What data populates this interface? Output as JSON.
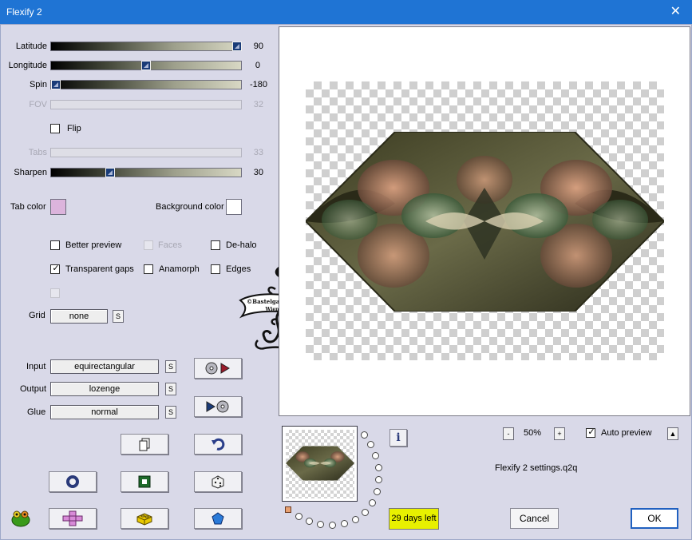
{
  "window": {
    "title": "Flexify 2",
    "close": "✕"
  },
  "sliders": [
    {
      "label": "Latitude",
      "value": "90",
      "pos": 1.0,
      "enabled": true
    },
    {
      "label": "Longitude",
      "value": "0",
      "pos": 0.5,
      "enabled": true
    },
    {
      "label": "Spin",
      "value": "-180",
      "pos": 0.0,
      "enabled": true
    },
    {
      "label": "FOV",
      "value": "32",
      "enabled": false
    },
    {
      "label": "Tabs",
      "value": "33",
      "enabled": false
    },
    {
      "label": "Sharpen",
      "value": "30",
      "pos": 0.3,
      "enabled": true
    }
  ],
  "flip": {
    "label": "Flip",
    "checked": false
  },
  "colors": {
    "tab_color_label": "Tab color",
    "tab_color": "#dcb4dc",
    "background_color_label": "Background color",
    "background_color": "#ffffff"
  },
  "options": {
    "better_preview": "Better preview",
    "faces": "Faces",
    "de_halo": "De-halo",
    "transparent_gaps": "Transparent gaps",
    "anamorph": "Anamorph",
    "edges": "Edges",
    "check_mark": "✓"
  },
  "grid": {
    "label": "Grid",
    "value": "none",
    "s": "S"
  },
  "projection": {
    "input_label": "Input",
    "input_value": "equirectangular",
    "output_label": "Output",
    "output_value": "lozenge",
    "glue_label": "Glue",
    "glue_value": "normal",
    "s": "S"
  },
  "watermark": {
    "text_line1": "©Bastelgarten",
    "text_line2": "Wien"
  },
  "zoom": {
    "minus": "-",
    "value": "50%",
    "plus": "+"
  },
  "auto_preview": {
    "label": "Auto preview",
    "checked": true,
    "arrow": "▲"
  },
  "info_icon": "i",
  "settings_file": "Flexify 2 settings.q2q",
  "trial": "29 days left",
  "buttons": {
    "cancel": "Cancel",
    "ok": "OK"
  },
  "accent": {
    "title_bar": "#1f74d4",
    "trial_badge": "#e8f000"
  }
}
